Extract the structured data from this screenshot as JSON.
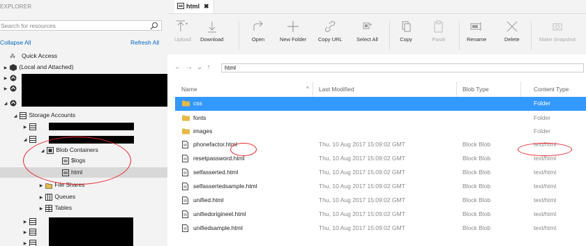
{
  "explorer": {
    "title": "EXPLORER",
    "search_placeholder": "Search for resources",
    "collapse_all": "Collapse All",
    "refresh_all": "Refresh All",
    "quick_access": "Quick Access",
    "local_attached": "(Local and Attached)",
    "storage_accounts": "Storage Accounts",
    "blob_containers": "Blob Containers",
    "logs": "$logs",
    "html": "html",
    "file_shares": "File Shares",
    "queues": "Queues",
    "tables": "Tables"
  },
  "tab": {
    "label": "html"
  },
  "toolbar": {
    "upload": "Upload",
    "download": "Download",
    "open": "Open",
    "new_folder": "New Folder",
    "copy_url": "Copy URL",
    "select_all": "Select All",
    "copy": "Copy",
    "paste": "Paste",
    "rename": "Rename",
    "delete": "Delete",
    "make_snapshot": "Make Snapshot"
  },
  "address": {
    "path": "html"
  },
  "columns": {
    "name": "Name",
    "last_modified": "Last Modified",
    "blob_type": "Blob Type",
    "content_type": "Content Type"
  },
  "rows": [
    {
      "name": "css",
      "modified": "",
      "blob_type": "",
      "content_type": "Folder",
      "kind": "folder"
    },
    {
      "name": "fonts",
      "modified": "",
      "blob_type": "",
      "content_type": "Folder",
      "kind": "folder"
    },
    {
      "name": "images",
      "modified": "",
      "blob_type": "",
      "content_type": "Folder",
      "kind": "folder"
    },
    {
      "name": "phonefactor.html",
      "modified": "Thu, 10 Aug 2017 15:09:02 GMT",
      "blob_type": "Block Blob",
      "content_type": "text/html",
      "kind": "file"
    },
    {
      "name": "resetpassword.html",
      "modified": "Thu, 10 Aug 2017 15:09:02 GMT",
      "blob_type": "Block Blob",
      "content_type": "text/html",
      "kind": "file"
    },
    {
      "name": "selfasserted.html",
      "modified": "Thu, 10 Aug 2017 15:09:02 GMT",
      "blob_type": "Block Blob",
      "content_type": "text/html",
      "kind": "file"
    },
    {
      "name": "selfassertedsample.html",
      "modified": "Thu, 10 Aug 2017 15:09:02 GMT",
      "blob_type": "Block Blob",
      "content_type": "text/html",
      "kind": "file"
    },
    {
      "name": "unified.html",
      "modified": "Thu, 10 Aug 2017 15:09:02 GMT",
      "blob_type": "Block Blob",
      "content_type": "text/html",
      "kind": "file"
    },
    {
      "name": "unifiedorigineel.html",
      "modified": "Thu, 10 Aug 2017 15:09:02 GMT",
      "blob_type": "Block Blob",
      "content_type": "text/html",
      "kind": "file"
    },
    {
      "name": "unifiedsample.html",
      "modified": "Thu, 10 Aug 2017 15:09:02 GMT",
      "blob_type": "Block Blob",
      "content_type": "text/html",
      "kind": "file"
    }
  ],
  "colors": {
    "selection": "#3399ff",
    "annotation": "#e8242a",
    "link": "#0066c0"
  }
}
